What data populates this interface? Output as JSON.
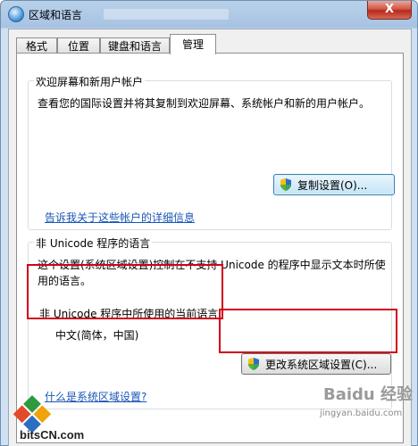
{
  "window": {
    "title": "区域和语言",
    "close_label": "X"
  },
  "tabs": [
    {
      "label": "格式"
    },
    {
      "label": "位置"
    },
    {
      "label": "键盘和语言"
    },
    {
      "label": "管理"
    }
  ],
  "welcome_group": {
    "title": "欢迎屏幕和新用户帐户",
    "description": "查看您的国际设置并将其复制到欢迎屏幕、系统帐户和新的用户帐户。",
    "copy_button": "复制设置(O)...",
    "link": "告诉我关于这些帐户的详细信息"
  },
  "unicode_group": {
    "title": "非 Unicode 程序的语言",
    "description_line1": "这个设置(系统区域设置)控制在不支持 Unicode 的程序中显示文本时所使",
    "description_line2": "用的语言。",
    "current_label": "非 Unicode 程序中所使用的当前语言:",
    "current_value": "中文(简体，中国)",
    "change_button": "更改系统区域设置(C)...",
    "link": "什么是系统区域设置?"
  },
  "watermark": {
    "brand_line1": "Baidu 经验",
    "brand_line2": "jingyan.baidu.com",
    "site_logo": "bitsCN.com"
  }
}
